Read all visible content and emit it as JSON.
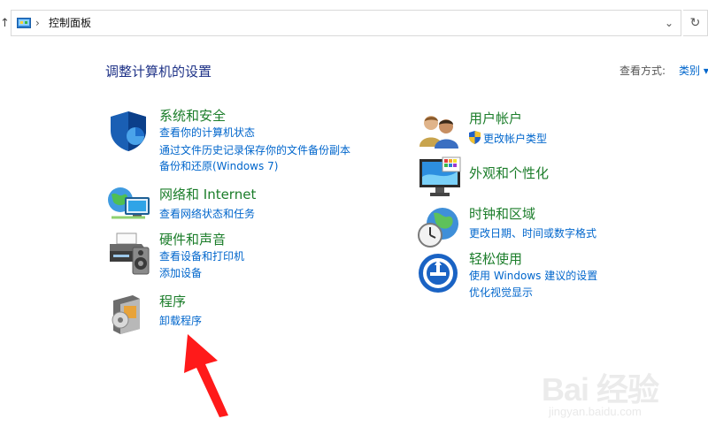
{
  "address_bar": {
    "up_glyph": "↑",
    "separator": "›",
    "path": "控制面板",
    "dropdown_glyph": "⌄",
    "refresh_glyph": "↻"
  },
  "header": {
    "title": "调整计算机的设置",
    "view_label": "查看方式:",
    "view_value": "类别",
    "view_dropdown_glyph": "▾"
  },
  "categories": {
    "system_security": {
      "title": "系统和安全",
      "links": [
        "查看你的计算机状态",
        "通过文件历史记录保存你的文件备份副本",
        "备份和还原(Windows 7)"
      ],
      "icon": "shield-icon"
    },
    "network": {
      "title": "网络和 Internet",
      "links": [
        "查看网络状态和任务"
      ],
      "icon": "network-icon"
    },
    "hardware": {
      "title": "硬件和声音",
      "links": [
        "查看设备和打印机",
        "添加设备"
      ],
      "icon": "printer-icon"
    },
    "programs": {
      "title": "程序",
      "links": [
        "卸载程序"
      ],
      "icon": "programs-icon"
    },
    "user_accounts": {
      "title": "用户帐户",
      "links": [
        "更改帐户类型"
      ],
      "icon": "users-icon"
    },
    "appearance": {
      "title": "外观和个性化",
      "links": [],
      "icon": "appearance-icon"
    },
    "clock_region": {
      "title": "时钟和区域",
      "links": [
        "更改日期、时间或数字格式"
      ],
      "icon": "clock-globe-icon"
    },
    "ease_of_access": {
      "title": "轻松使用",
      "links": [
        "使用 Windows 建议的设置",
        "优化视觉显示"
      ],
      "icon": "ease-of-access-icon"
    }
  },
  "annotation": {
    "arrow_color": "#ff1a1a"
  },
  "watermark": {
    "main": "Bai 经验",
    "sub": "jingyan.baidu.com"
  }
}
